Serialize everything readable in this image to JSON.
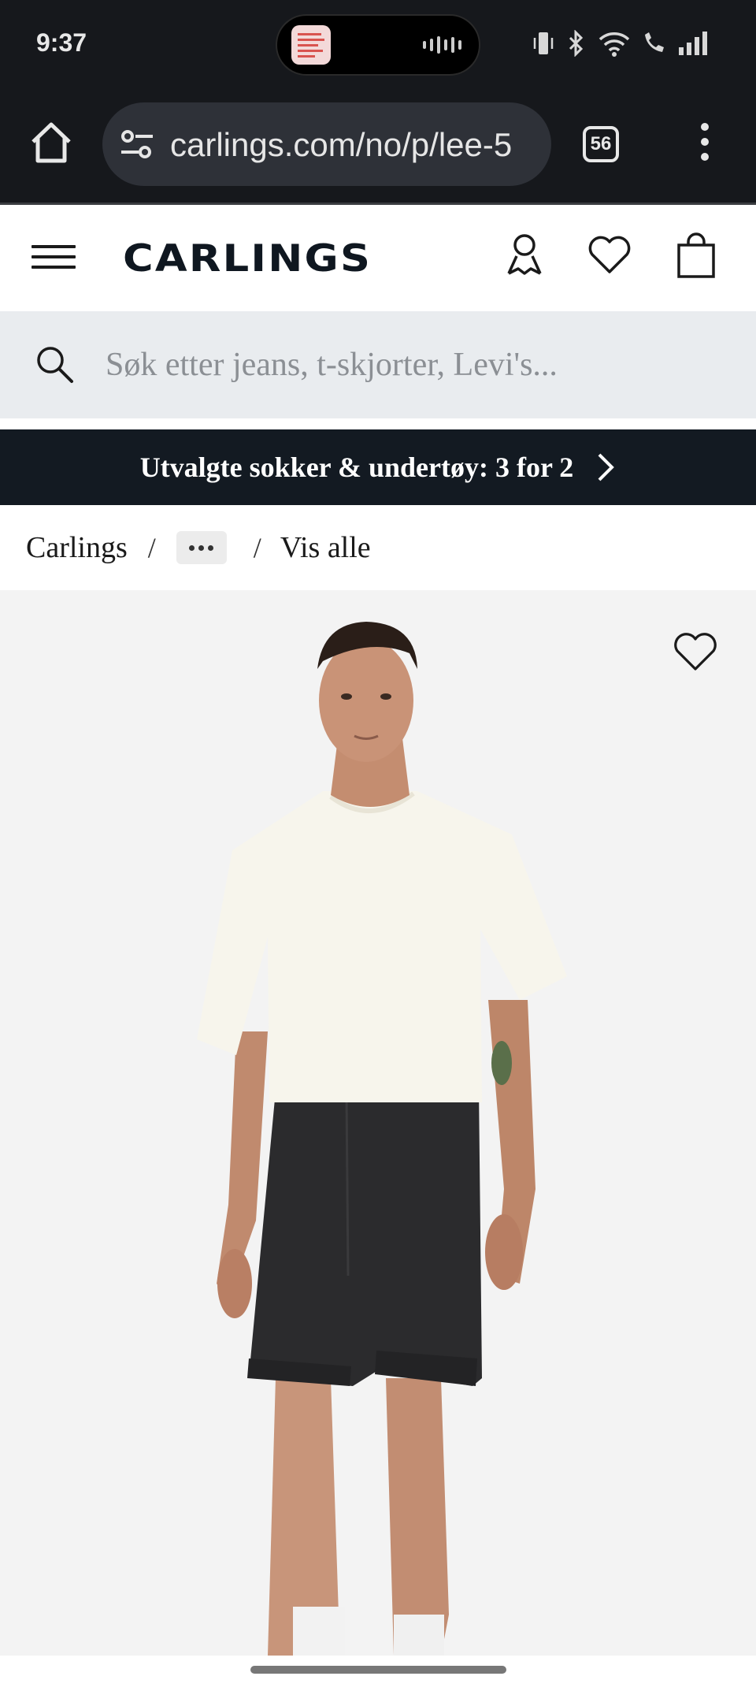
{
  "status_bar": {
    "time": "9:37"
  },
  "browser": {
    "url": "carlings.com/no/p/lee-5",
    "tab_count": "56"
  },
  "site": {
    "logo": "CARLINGS",
    "search_placeholder": "Søk etter jeans, t-skjorter, Levi's...",
    "promo": "Utvalgte sokker & undertøy: 3 for 2",
    "breadcrumb": {
      "home": "Carlings",
      "separator": "/",
      "current": "Vis alle"
    }
  },
  "colors": {
    "status_bar_bg": "#16181c",
    "promo_bg": "#131a22",
    "search_bg": "#e9ecef",
    "product_bg": "#f3f3f3"
  },
  "icons": [
    "home-icon",
    "tune-icon",
    "tabs-icon",
    "more-vert-icon",
    "hamburger-icon",
    "account-icon",
    "heart-icon",
    "bag-icon",
    "search-icon",
    "chevron-right-icon"
  ]
}
